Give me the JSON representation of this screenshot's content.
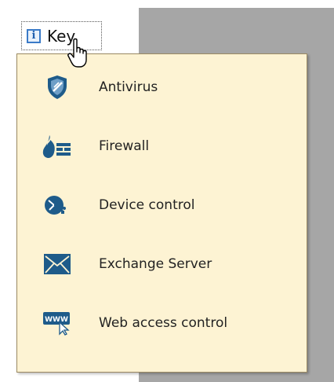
{
  "key_button": {
    "info_glyph": "i",
    "label": "Key"
  },
  "legend": {
    "items": [
      {
        "label": "Antivirus",
        "icon": "antivirus-shield-icon"
      },
      {
        "label": "Firewall",
        "icon": "firewall-icon"
      },
      {
        "label": "Device control",
        "icon": "device-control-icon"
      },
      {
        "label": "Exchange Server",
        "icon": "envelope-icon"
      },
      {
        "label": "Web access control",
        "icon": "web-access-icon"
      }
    ]
  },
  "colors": {
    "icon_blue": "#1e5b8a",
    "popup_bg": "#fdf3d3",
    "gray_panel": "#a6a6a6"
  }
}
